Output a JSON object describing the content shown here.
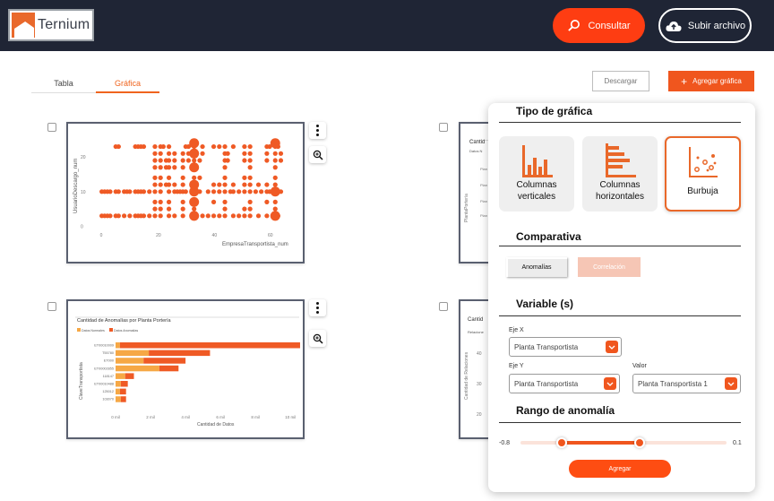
{
  "header": {
    "logo_text": "Ternium",
    "consultar_label": "Consultar",
    "subir_label": "Subir archivo"
  },
  "tabs": [
    {
      "label": "Tabla",
      "active": false
    },
    {
      "label": "Gráfica",
      "active": true
    }
  ],
  "toolbar": {
    "descargar_label": "Descargar",
    "agregar_grafica_label": "Agregar gráfica"
  },
  "charts": [
    {
      "type": "scatter",
      "xlabel": "EmpresaTransportista_num",
      "ylabel": "UsuarioDescargo_num",
      "xticks": [
        "0",
        "20",
        "40",
        "60"
      ],
      "yticks": [
        "20",
        "10",
        "0"
      ]
    },
    {
      "type": "bar",
      "title": "Cantidad de Anomalías por Planta Portería",
      "legend": [
        "Datos Normales",
        "Datos Anomalías"
      ],
      "xlabel": "Cantidad de Datos",
      "ylabel": "ClaveTransportista",
      "categories": [
        "ET00010009",
        "T55780",
        "ET000",
        "ET00002855",
        "118147",
        "ET00010488",
        "125012",
        "103070"
      ],
      "xticks": [
        "0 mil",
        "2 mil",
        "4 mil",
        "6 mil",
        "8 mil",
        "10 mil"
      ]
    },
    {
      "partial_title": "Cantid",
      "legend_fragment": "Datos N",
      "ylabel_fragment": "PlantaPortería",
      "row_label_fragment": "Plan"
    },
    {
      "partial_title": "Cantid",
      "legend_fragment": "Relacione",
      "ylabel_fragment": "Cantidad de Relaciones",
      "yticks": [
        "40",
        "30",
        "20"
      ]
    }
  ],
  "chart_data": [
    {
      "type": "scatter",
      "xlabel": "EmpresaTransportista_num",
      "ylabel": "UsuarioDescargo_num",
      "xlim": [
        -5,
        68
      ],
      "ylim": [
        -3,
        26
      ],
      "points": [
        [
          5,
          23
        ],
        [
          6,
          23
        ],
        [
          12,
          23
        ],
        [
          13,
          23
        ],
        [
          14,
          23
        ],
        [
          15,
          23
        ],
        [
          19,
          23
        ],
        [
          21,
          23
        ],
        [
          22,
          23
        ],
        [
          24,
          23
        ],
        [
          30,
          23
        ],
        [
          31,
          23
        ],
        [
          33,
          23
        ],
        [
          36,
          23
        ],
        [
          40,
          23
        ],
        [
          42,
          23
        ],
        [
          44,
          23
        ],
        [
          47,
          23
        ],
        [
          51,
          23
        ],
        [
          53,
          23
        ],
        [
          59,
          23
        ],
        [
          60,
          23
        ],
        [
          62,
          23
        ],
        [
          63,
          23
        ],
        [
          19,
          21
        ],
        [
          21,
          21
        ],
        [
          24,
          21
        ],
        [
          26,
          21
        ],
        [
          29,
          21
        ],
        [
          31,
          21
        ],
        [
          33,
          21
        ],
        [
          36,
          21
        ],
        [
          44,
          21
        ],
        [
          45,
          21
        ],
        [
          51,
          21
        ],
        [
          53,
          21
        ],
        [
          59,
          21
        ],
        [
          62,
          21
        ],
        [
          64,
          21
        ],
        [
          19,
          19
        ],
        [
          21,
          19
        ],
        [
          23,
          19
        ],
        [
          24,
          19
        ],
        [
          26,
          19
        ],
        [
          29,
          19
        ],
        [
          31,
          19
        ],
        [
          33,
          19
        ],
        [
          35,
          19
        ],
        [
          44,
          19
        ],
        [
          45,
          19
        ],
        [
          51,
          19
        ],
        [
          53,
          19
        ],
        [
          59,
          19
        ],
        [
          62,
          19
        ],
        [
          64,
          19
        ],
        [
          19,
          17
        ],
        [
          21,
          17
        ],
        [
          23,
          17
        ],
        [
          24,
          17
        ],
        [
          26,
          17
        ],
        [
          29,
          17
        ],
        [
          33,
          17
        ],
        [
          44,
          17
        ],
        [
          53,
          17
        ],
        [
          62,
          17
        ],
        [
          19,
          14
        ],
        [
          21,
          14
        ],
        [
          24,
          14
        ],
        [
          29,
          14
        ],
        [
          33,
          14
        ],
        [
          35,
          14
        ],
        [
          44,
          14
        ],
        [
          51,
          14
        ],
        [
          53,
          14
        ],
        [
          62,
          14
        ],
        [
          19,
          12
        ],
        [
          21,
          12
        ],
        [
          23,
          12
        ],
        [
          24,
          12
        ],
        [
          26,
          12
        ],
        [
          29,
          12
        ],
        [
          33,
          12
        ],
        [
          40,
          12
        ],
        [
          42,
          12
        ],
        [
          44,
          12
        ],
        [
          47,
          12
        ],
        [
          51,
          12
        ],
        [
          53,
          12
        ],
        [
          56,
          12
        ],
        [
          59,
          12
        ],
        [
          62,
          12
        ],
        [
          0,
          10
        ],
        [
          1,
          10
        ],
        [
          2,
          10
        ],
        [
          3,
          10
        ],
        [
          5,
          10
        ],
        [
          6,
          10
        ],
        [
          8,
          10
        ],
        [
          9,
          10
        ],
        [
          10,
          10
        ],
        [
          12,
          10
        ],
        [
          13,
          10
        ],
        [
          14,
          10
        ],
        [
          15,
          10
        ],
        [
          17,
          10
        ],
        [
          19,
          10
        ],
        [
          21,
          10
        ],
        [
          24,
          10
        ],
        [
          26,
          10
        ],
        [
          27,
          10
        ],
        [
          28,
          10
        ],
        [
          29,
          10
        ],
        [
          30,
          10
        ],
        [
          33,
          10
        ],
        [
          35,
          10
        ],
        [
          38,
          10
        ],
        [
          40,
          10
        ],
        [
          42,
          10
        ],
        [
          44,
          10
        ],
        [
          46,
          10
        ],
        [
          47,
          10
        ],
        [
          49,
          10
        ],
        [
          51,
          10
        ],
        [
          53,
          10
        ],
        [
          55,
          10
        ],
        [
          57,
          10
        ],
        [
          59,
          10
        ],
        [
          60,
          10
        ],
        [
          62,
          10
        ],
        [
          63,
          10
        ],
        [
          64,
          10
        ],
        [
          19,
          7
        ],
        [
          21,
          7
        ],
        [
          24,
          7
        ],
        [
          29,
          7
        ],
        [
          33,
          7
        ],
        [
          40,
          7
        ],
        [
          44,
          7
        ],
        [
          53,
          7
        ],
        [
          59,
          7
        ],
        [
          62,
          7
        ],
        [
          19,
          5
        ],
        [
          21,
          5
        ],
        [
          24,
          5
        ],
        [
          29,
          5
        ],
        [
          33,
          5
        ],
        [
          44,
          5
        ],
        [
          51,
          5
        ],
        [
          53,
          5
        ],
        [
          62,
          5
        ],
        [
          0,
          3
        ],
        [
          1,
          3
        ],
        [
          2,
          3
        ],
        [
          3,
          3
        ],
        [
          5,
          3
        ],
        [
          6,
          3
        ],
        [
          8,
          3
        ],
        [
          10,
          3
        ],
        [
          12,
          3
        ],
        [
          13,
          3
        ],
        [
          14,
          3
        ],
        [
          15,
          3
        ],
        [
          17,
          3
        ],
        [
          19,
          3
        ],
        [
          21,
          3
        ],
        [
          24,
          3
        ],
        [
          26,
          3
        ],
        [
          29,
          3
        ],
        [
          33,
          3
        ],
        [
          36,
          3
        ],
        [
          38,
          3
        ],
        [
          40,
          3
        ],
        [
          42,
          3
        ],
        [
          44,
          3
        ],
        [
          47,
          3
        ],
        [
          49,
          3
        ],
        [
          51,
          3
        ],
        [
          53,
          3
        ],
        [
          56,
          3
        ],
        [
          59,
          3
        ],
        [
          62,
          3
        ],
        [
          63,
          3
        ]
      ],
      "large_points": [
        [
          33,
          24
        ],
        [
          33,
          21
        ],
        [
          33,
          17
        ],
        [
          33,
          12
        ],
        [
          33,
          10
        ],
        [
          33,
          7
        ],
        [
          33,
          3
        ],
        [
          62,
          10
        ],
        [
          62,
          3
        ],
        [
          62,
          24
        ]
      ]
    },
    {
      "type": "bar",
      "title": "Cantidad de Anomalías por Planta Portería",
      "xlabel": "Cantidad de Datos",
      "ylabel": "ClaveTransportista",
      "xlim": [
        0,
        10500
      ],
      "categories": [
        "ET00010009",
        "T55780",
        "ET000",
        "ET00002855",
        "118147",
        "ET00010488",
        "125012",
        "103070"
      ],
      "series": [
        {
          "name": "Datos Normales",
          "values": [
            250,
            1900,
            1600,
            2500,
            550,
            300,
            250,
            300
          ]
        },
        {
          "name": "Datos Anomalías",
          "values": [
            10300,
            3500,
            2400,
            1100,
            500,
            400,
            350,
            300
          ]
        }
      ]
    }
  ],
  "panel": {
    "tipo_title": "Tipo de gráfica",
    "chart_types": [
      {
        "label": "Columnas verticales",
        "selected": false
      },
      {
        "label": "Columnas horizontales",
        "selected": false
      },
      {
        "label": "Burbuja",
        "selected": true
      }
    ],
    "comparativa_title": "Comparativa",
    "comparativa_options": [
      {
        "label": "Anomalías",
        "selected": true
      },
      {
        "label": "Correlación",
        "selected": false
      }
    ],
    "variable_title": "Variable (s)",
    "eje_x_label": "Eje X",
    "eje_x_value": "Planta Transportista",
    "eje_y_label": "Eje Y",
    "eje_y_value": "Planta Transportista",
    "valor_label": "Valor",
    "valor_value": "Planta Transportista 1",
    "rango_title": "Rango de anomalía",
    "rango_min": "-0.8",
    "rango_max": "0.1",
    "rango_low_fraction": 0.2,
    "rango_high_fraction": 0.58,
    "agregar_label": "Agregar"
  },
  "colors": {
    "accent": "#f0561e",
    "header_bg": "#1f2535",
    "normal_bar": "#f6a845",
    "anomaly_bar": "#ef5a25"
  }
}
